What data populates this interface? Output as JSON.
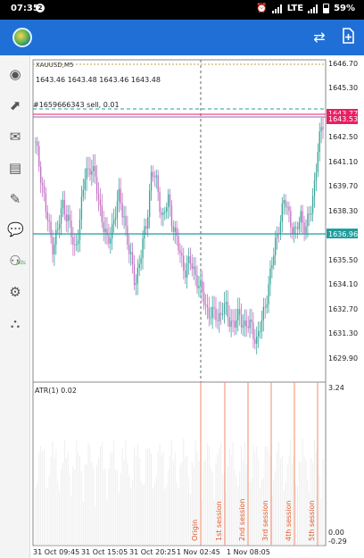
{
  "status_bar": {
    "time": "07:35",
    "notification_count": "2",
    "network": "LTE",
    "battery": "59%"
  },
  "app_bar": {
    "icons": [
      "app-logo-icon",
      "one-click-trading-icon",
      "new-order-icon"
    ]
  },
  "sidebar": {
    "items": [
      {
        "icon": "quotes-icon"
      },
      {
        "icon": "chart-icon"
      },
      {
        "icon": "mail-icon"
      },
      {
        "icon": "news-icon"
      },
      {
        "icon": "trading-ads-icon",
        "badge": "Ads"
      },
      {
        "icon": "chat-icon"
      },
      {
        "icon": "community-icon"
      },
      {
        "icon": "settings-icon"
      },
      {
        "icon": "signals-icon"
      }
    ]
  },
  "chart": {
    "symbol": "XAUUSD,M5",
    "ohlc": "1643.46 1643.48 1643.46 1643.48",
    "position_label": "#1659666343 sell, 0.01",
    "price_labels": [
      "1646.70",
      "1645.30",
      "1643.90",
      "1642.50",
      "1641.10",
      "1639.70",
      "1638.30",
      "1636.90",
      "1635.50",
      "1634.10",
      "1632.70",
      "1631.30",
      "1629.90"
    ],
    "ask_label": "1643.77",
    "bid_label": "1643.53",
    "position_price_label": "1636.96",
    "indicator": {
      "label": "ATR(1) 0.02",
      "max": "3.24",
      "min": "0.00",
      "min2": "-0.29"
    },
    "time_labels": [
      "31 Oct 09:45",
      "31 Oct 15:05",
      "31 Oct 20:25",
      "1 Nov 02:45",
      "1 Nov 08:05"
    ],
    "session_labels": [
      "Origin",
      "1st session",
      "2nd session",
      "3rd session",
      "4th session",
      "5th session"
    ],
    "colors": {
      "bull": "#3aa59a",
      "bear": "#c272c4",
      "bid_line": "#e91e63",
      "position_line": "#1e9e9e",
      "session_line": "#f28b6b"
    }
  },
  "chart_data": {
    "type": "candlestick",
    "symbol": "XAUUSD",
    "timeframe": "M5",
    "ylim": [
      1629.2,
      1647.1
    ],
    "series_close_approx": [
      1642.3,
      1640.7,
      1638.4,
      1636.8,
      1637.6,
      1639.2,
      1638.1,
      1636.4,
      1638.2,
      1640.8,
      1641.3,
      1640.0,
      1638.4,
      1636.7,
      1638.1,
      1639.4,
      1638.5,
      1636.2,
      1634.8,
      1636.1,
      1638.0,
      1640.9,
      1640.1,
      1638.2,
      1639.3,
      1637.8,
      1636.4,
      1635.5,
      1635.8,
      1635.2,
      1634.1,
      1633.3,
      1632.9,
      1632.8,
      1633.4,
      1632.7,
      1632.5,
      1632.8,
      1632.4,
      1632.2,
      1631.6,
      1632.5,
      1634.4,
      1636.1,
      1638.0,
      1639.2,
      1638.4,
      1637.3,
      1638.5,
      1637.7,
      1639.0,
      1642.0,
      1643.5
    ]
  }
}
